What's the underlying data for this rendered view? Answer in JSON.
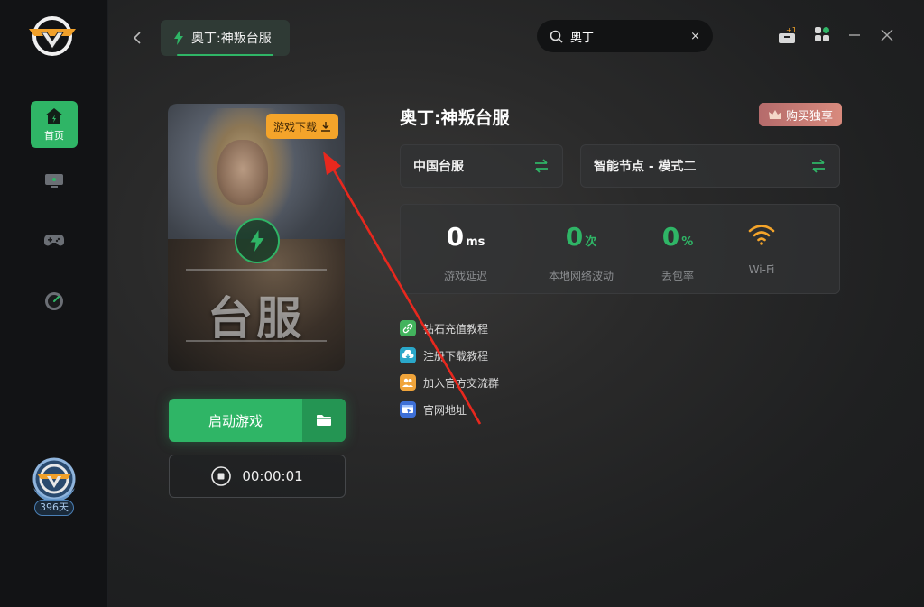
{
  "sidebar": {
    "home_label": "首页",
    "days_badge": "396天",
    "items": [
      {
        "name": "home",
        "label": "首页",
        "active": true
      },
      {
        "name": "monitor",
        "label": ""
      },
      {
        "name": "gamepad",
        "label": ""
      },
      {
        "name": "speed",
        "label": ""
      }
    ]
  },
  "header": {
    "tab_title": "奥丁:神叛台服",
    "search_value": "奥丁",
    "clear_symbol": "×"
  },
  "card": {
    "download_label": "游戏下载",
    "art_text": "台服"
  },
  "actions": {
    "launch_label": "启动游戏",
    "timer": "00:00:01"
  },
  "game": {
    "title": "奥丁:神叛台服",
    "buy_label": "购买独享",
    "server": "中国台服",
    "node": "智能节点 - 模式二"
  },
  "stats": [
    {
      "value": "0",
      "unit": "ms",
      "label": "游戏延迟",
      "color": "#ffffff"
    },
    {
      "value": "0",
      "unit": "次",
      "label": "本地网络波动",
      "color": "#2fb566"
    },
    {
      "value": "0",
      "unit": "%",
      "label": "丢包率",
      "color": "#2fb566"
    },
    {
      "value": "",
      "unit": "",
      "label": "Wi-Fi",
      "color": "#f4a42a"
    }
  ],
  "links": [
    {
      "label": "钻石充值教程",
      "icon": "link-icon",
      "color": "#43b35d"
    },
    {
      "label": "注册下载教程",
      "icon": "cloud-download-icon",
      "color": "#2aa7c9"
    },
    {
      "label": "加入官方交流群",
      "icon": "group-icon",
      "color": "#f0a43a"
    },
    {
      "label": "官网地址",
      "icon": "website-icon",
      "color": "#3d6fd6"
    }
  ],
  "colors": {
    "accent": "#2fb566",
    "download": "#f4a42a",
    "annotation_arrow": "#e8281e"
  }
}
